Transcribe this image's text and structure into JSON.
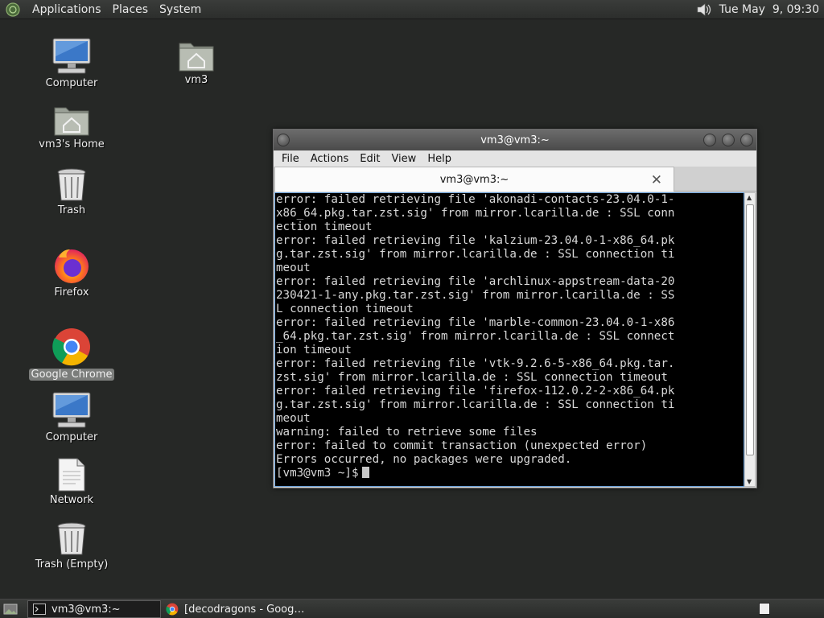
{
  "top_panel": {
    "menus": [
      "Applications",
      "Places",
      "System"
    ],
    "clock": "Tue May  9, 09:30"
  },
  "desktop": {
    "icons": [
      {
        "label": "Computer",
        "icon": "computer-icon"
      },
      {
        "label": "vm3's Home",
        "icon": "home-folder-icon"
      },
      {
        "label": "Trash",
        "icon": "trash-icon"
      },
      {
        "label": "Firefox",
        "icon": "firefox-icon"
      },
      {
        "label": "Google Chrome",
        "icon": "chrome-icon"
      },
      {
        "label": "Computer",
        "icon": "computer-icon"
      },
      {
        "label": "Network",
        "icon": "document-icon"
      },
      {
        "label": "Trash (Empty)",
        "icon": "trash-icon"
      },
      {
        "label": "vm3",
        "icon": "home-folder-icon"
      }
    ]
  },
  "terminal": {
    "title": "vm3@vm3:~",
    "menu": [
      "File",
      "Actions",
      "Edit",
      "View",
      "Help"
    ],
    "tab_title": "vm3@vm3:~",
    "tab_close": "✕",
    "lines": [
      "error: failed retrieving file 'akonadi-contacts-23.04.0-1-",
      "x86_64.pkg.tar.zst.sig' from mirror.lcarilla.de : SSL conn",
      "ection timeout",
      "error: failed retrieving file 'kalzium-23.04.0-1-x86_64.pk",
      "g.tar.zst.sig' from mirror.lcarilla.de : SSL connection ti",
      "meout",
      "error: failed retrieving file 'archlinux-appstream-data-20",
      "230421-1-any.pkg.tar.zst.sig' from mirror.lcarilla.de : SS",
      "L connection timeout",
      "error: failed retrieving file 'marble-common-23.04.0-1-x86",
      "_64.pkg.tar.zst.sig' from mirror.lcarilla.de : SSL connect",
      "ion timeout",
      "error: failed retrieving file 'vtk-9.2.6-5-x86_64.pkg.tar.",
      "zst.sig' from mirror.lcarilla.de : SSL connection timeout",
      "error: failed retrieving file 'firefox-112.0.2-2-x86_64.pk",
      "g.tar.zst.sig' from mirror.lcarilla.de : SSL connection ti",
      "meout",
      "warning: failed to retrieve some files",
      "error: failed to commit transaction (unexpected error)",
      "Errors occurred, no packages were upgraded."
    ],
    "prompt": "[vm3@vm3 ~]$"
  },
  "taskbar": {
    "tasks": [
      {
        "label": "vm3@vm3:~",
        "icon": "terminal-icon"
      },
      {
        "label": "[decodragons - Goog…",
        "icon": "chrome-icon"
      }
    ]
  }
}
